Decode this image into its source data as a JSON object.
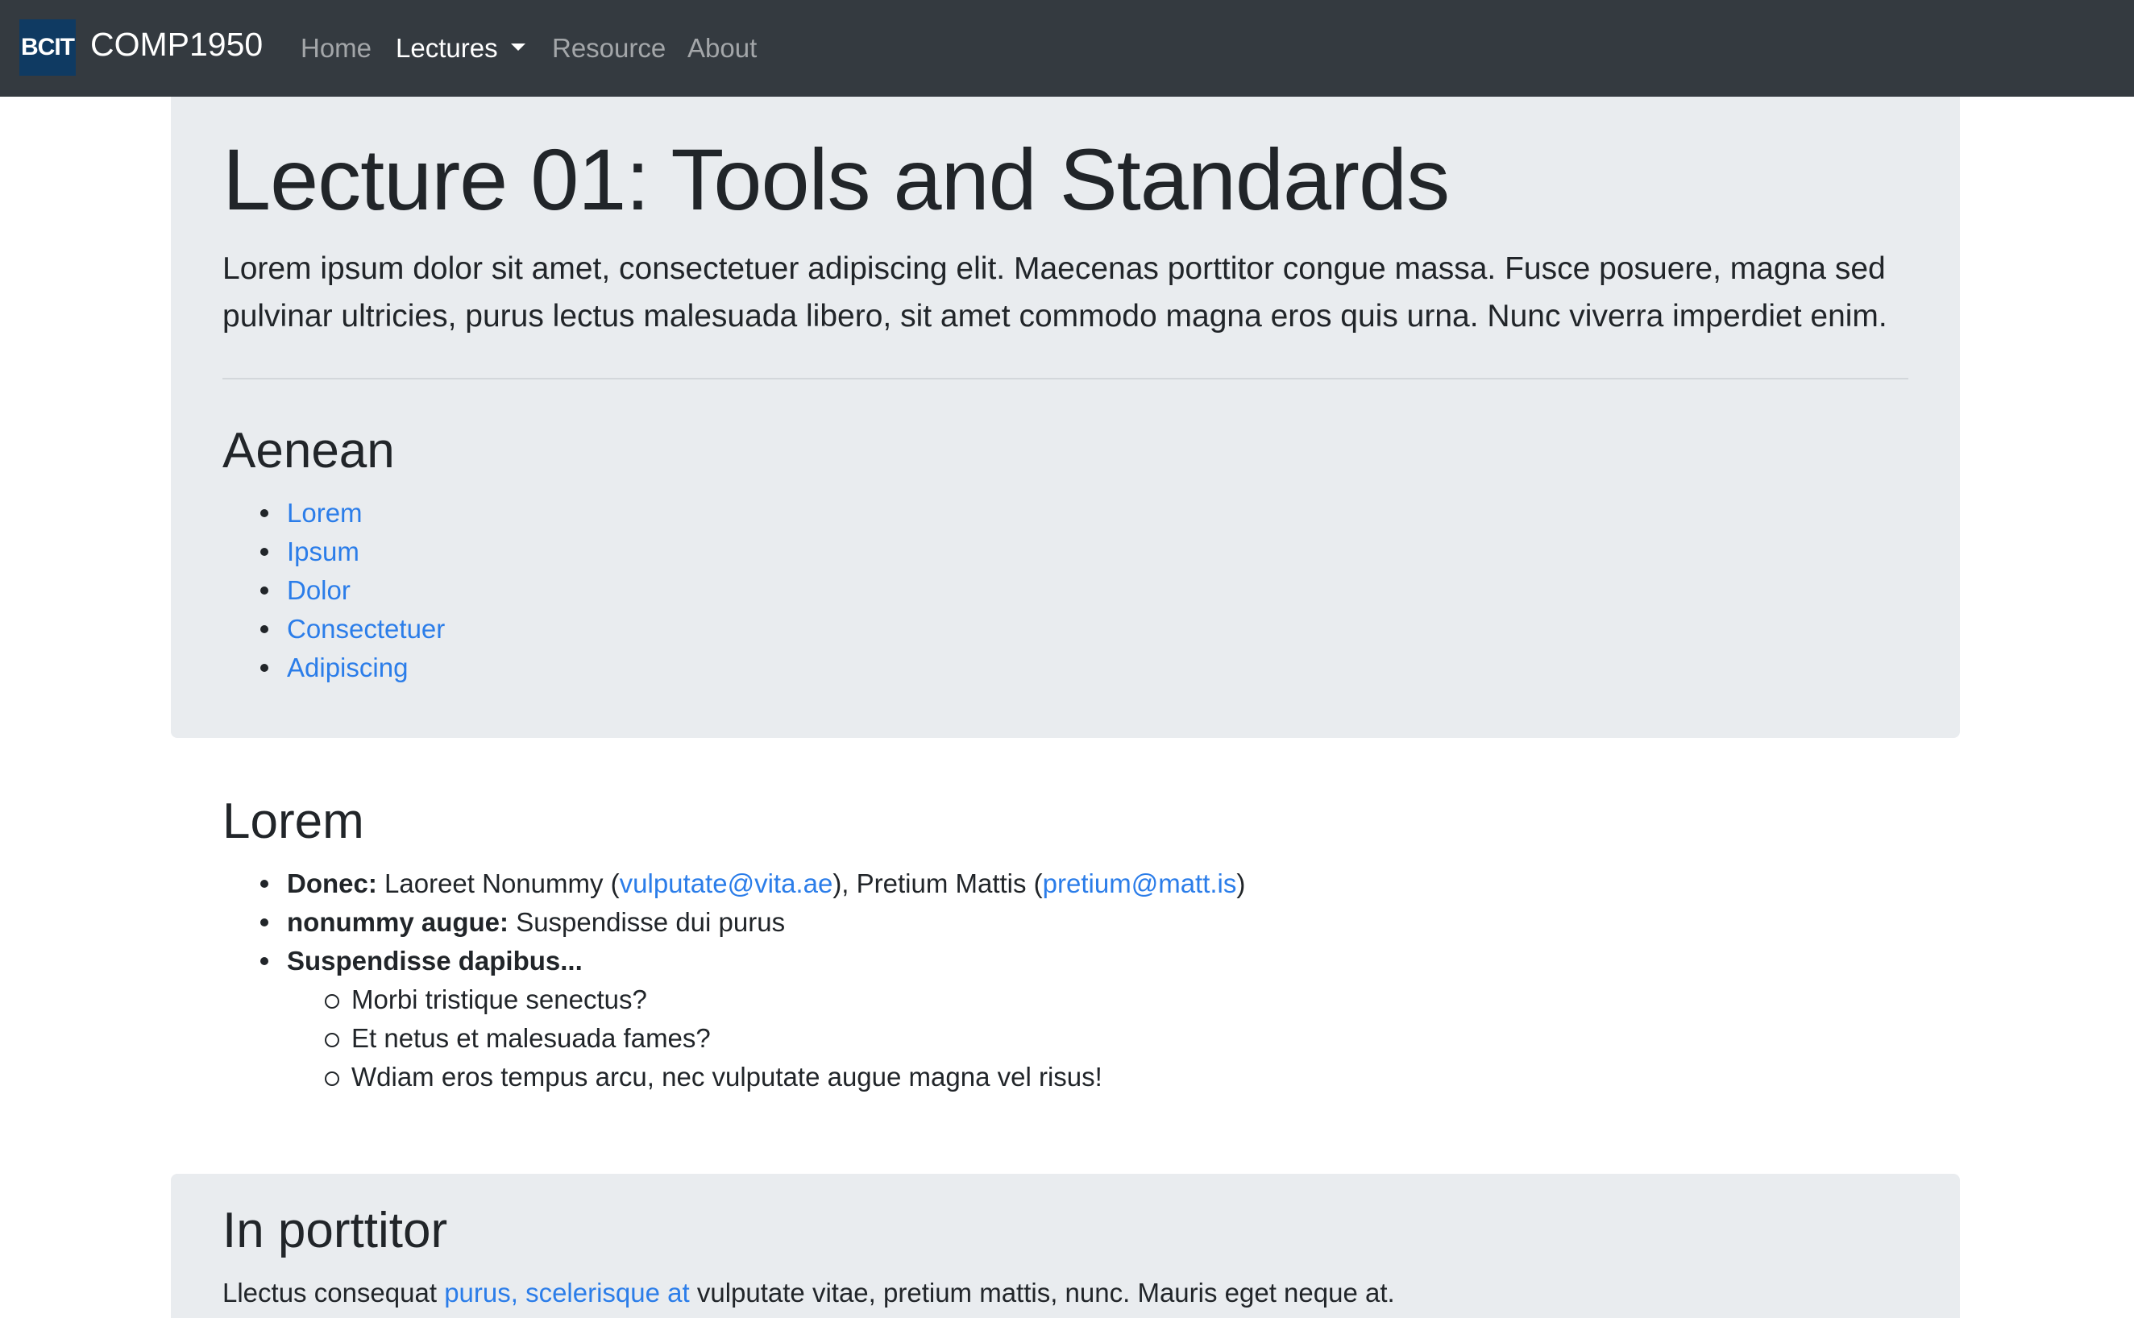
{
  "navbar": {
    "logo_text": "BCIT",
    "brand": "COMP1950",
    "links": [
      {
        "label": "Home",
        "active": false
      },
      {
        "label": "Lectures",
        "active": true,
        "dropdown": true
      },
      {
        "label": "Resource",
        "active": false
      },
      {
        "label": "About",
        "active": false
      }
    ]
  },
  "jumbotron": {
    "title": "Lecture 01: Tools and Standards",
    "lead": "Lorem ipsum dolor sit amet, consectetuer adipiscing elit. Maecenas porttitor congue massa. Fusce posuere, magna sed pulvinar ultricies, purus lectus malesuada libero, sit amet commodo magna eros quis urna. Nunc viverra imperdiet enim.",
    "section_heading": "Aenean",
    "links": [
      "Lorem",
      "Ipsum",
      "Dolor",
      "Consectetuer",
      "Adipiscing"
    ]
  },
  "lorem_section": {
    "heading": "Lorem",
    "items": {
      "donec_label": "Donec:",
      "donec_name1": "Laoreet Nonummy (",
      "donec_email1": "vulputate@vita.ae",
      "donec_between": "), Pretium Mattis (",
      "donec_email2": "pretium@matt.is",
      "donec_end": ")",
      "nonummy_label": "nonummy augue:",
      "nonummy_text": "Suspendisse dui purus",
      "suspendisse_label": "Suspendisse dapibus...",
      "sub_items": [
        "Morbi tristique senectus?",
        "Et netus et malesuada fames?",
        "Wdiam eros tempus arcu, nec vulputate augue magna vel risus!"
      ]
    }
  },
  "porttitor_section": {
    "heading": "In porttitor",
    "text_before": "Llectus consequat ",
    "link": "purus, scelerisque at",
    "text_after": " vulputate vitae, pretium mattis, nunc. Mauris eget neque at."
  },
  "colors": {
    "navbar_bg": "#343a40",
    "logo_bg": "#0f3a62",
    "panel_bg": "#e9ecef",
    "link": "#2b7de9",
    "text": "#212529"
  }
}
